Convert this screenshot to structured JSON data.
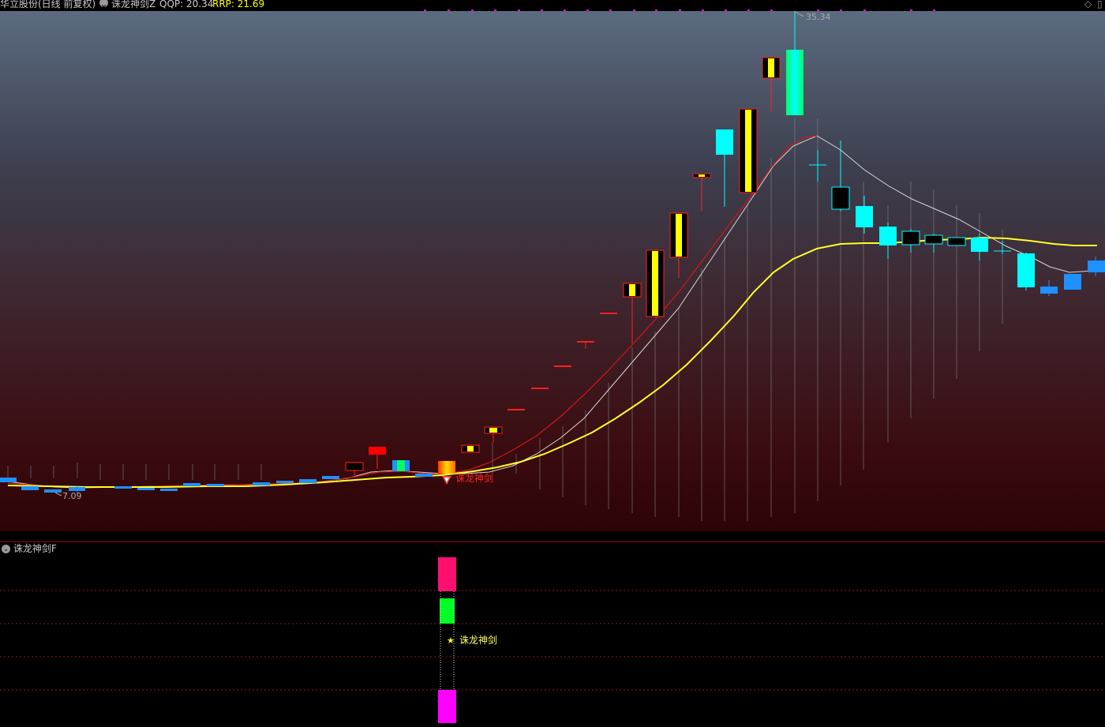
{
  "header": {
    "stock_title": "华立股份(日线 前复权)",
    "indicator_name": "诛龙神剑Z",
    "qqp_label": "QQP: 20.34",
    "rrp_label": "RRP: 21.69",
    "right_icon": "diamond-icon"
  },
  "main_chart": {
    "high_label": "35.34",
    "low_label": "7.09",
    "signal_label": "诛龙神剑"
  },
  "sub_chart": {
    "title": "诛龙神剑F",
    "signal_label": "诛龙神剑"
  },
  "colors": {
    "yellow": "#ffff00",
    "cyan": "#00ffff",
    "blue": "#1e90ff",
    "red": "#ff0000",
    "green": "#00ff22",
    "pink": "#ff1070",
    "magenta": "#ff00ff",
    "ma_red": "#d01818",
    "ma_white": "#d8d8d8",
    "ma_yellow": "#ffff2a"
  },
  "chart_data": {
    "type": "candlestick",
    "series": [
      {
        "name": "QQP",
        "value": 20.34
      },
      {
        "name": "RRP",
        "value": 21.69
      }
    ],
    "price_range": [
      7.09,
      35.34
    ],
    "signal": "诛龙神剑"
  }
}
